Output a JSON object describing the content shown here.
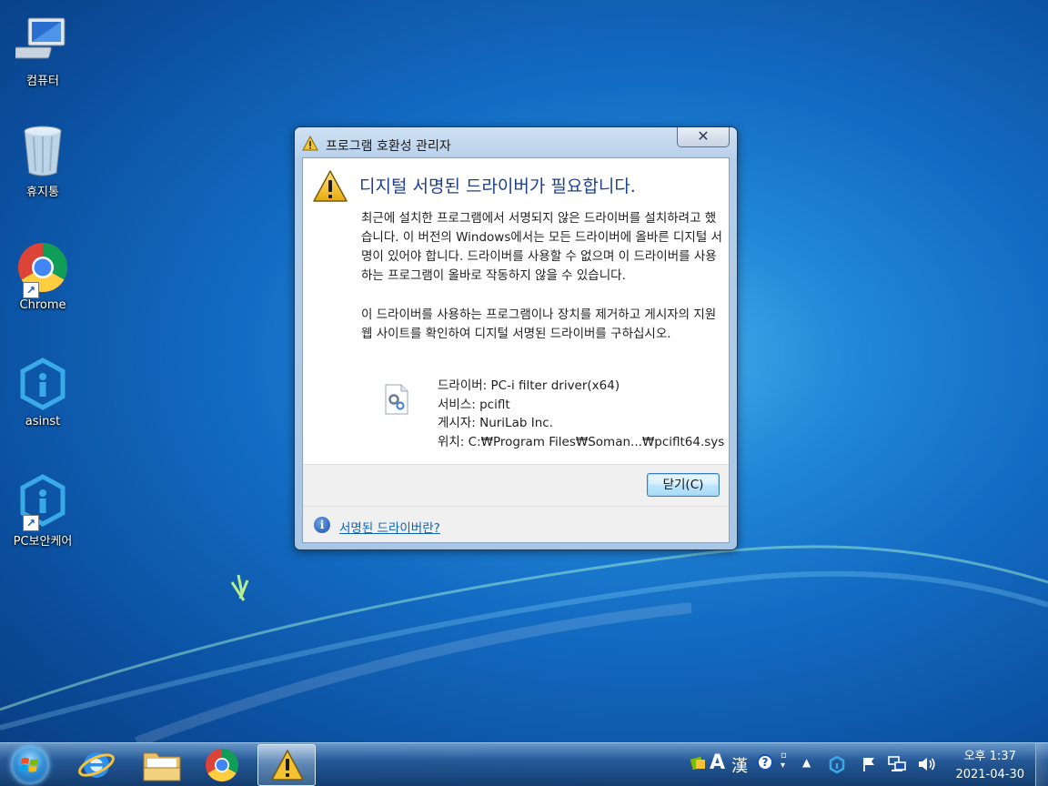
{
  "desktop": {
    "icons": [
      {
        "label": "컴퓨터"
      },
      {
        "label": "휴지통"
      },
      {
        "label": "Chrome"
      },
      {
        "label": "asinst"
      },
      {
        "label": "PC보안케어"
      }
    ]
  },
  "dialog": {
    "title": "프로그램 호환성 관리자",
    "close_glyph": "✕",
    "headline": "디지털 서명된 드라이버가 필요합니다.",
    "paragraph1": "최근에 설치한 프로그램에서 서명되지 않은 드라이버를 설치하려고 했습니다. 이 버전의 Windows에서는 모든 드라이버에 올바른 디지털 서명이 있어야 합니다. 드라이버를 사용할 수 없으며 이 드라이버를 사용하는 프로그램이 올바로 작동하지 않을 수 있습니다.",
    "paragraph2": "이 드라이버를 사용하는 프로그램이나 장치를 제거하고 게시자의 지원 웹 사이트를 확인하여 디지털 서명된 드라이버를 구하십시오.",
    "details": {
      "driver": "드라이버: PC-i filter driver(x64)",
      "service": "서비스: pciflt",
      "publisher": "게시자: NuriLab Inc.",
      "location": "위치: C:₩Program Files₩Soman...₩pciflt64.sys"
    },
    "close_button": "닫기(C)",
    "info_link": "서명된 드라이버란?"
  },
  "taskbar": {
    "ime_mode": "A",
    "ime_hanja": "漢",
    "clock_ampm_time": "오후 1:37",
    "clock_date": "2021-04-30"
  }
}
